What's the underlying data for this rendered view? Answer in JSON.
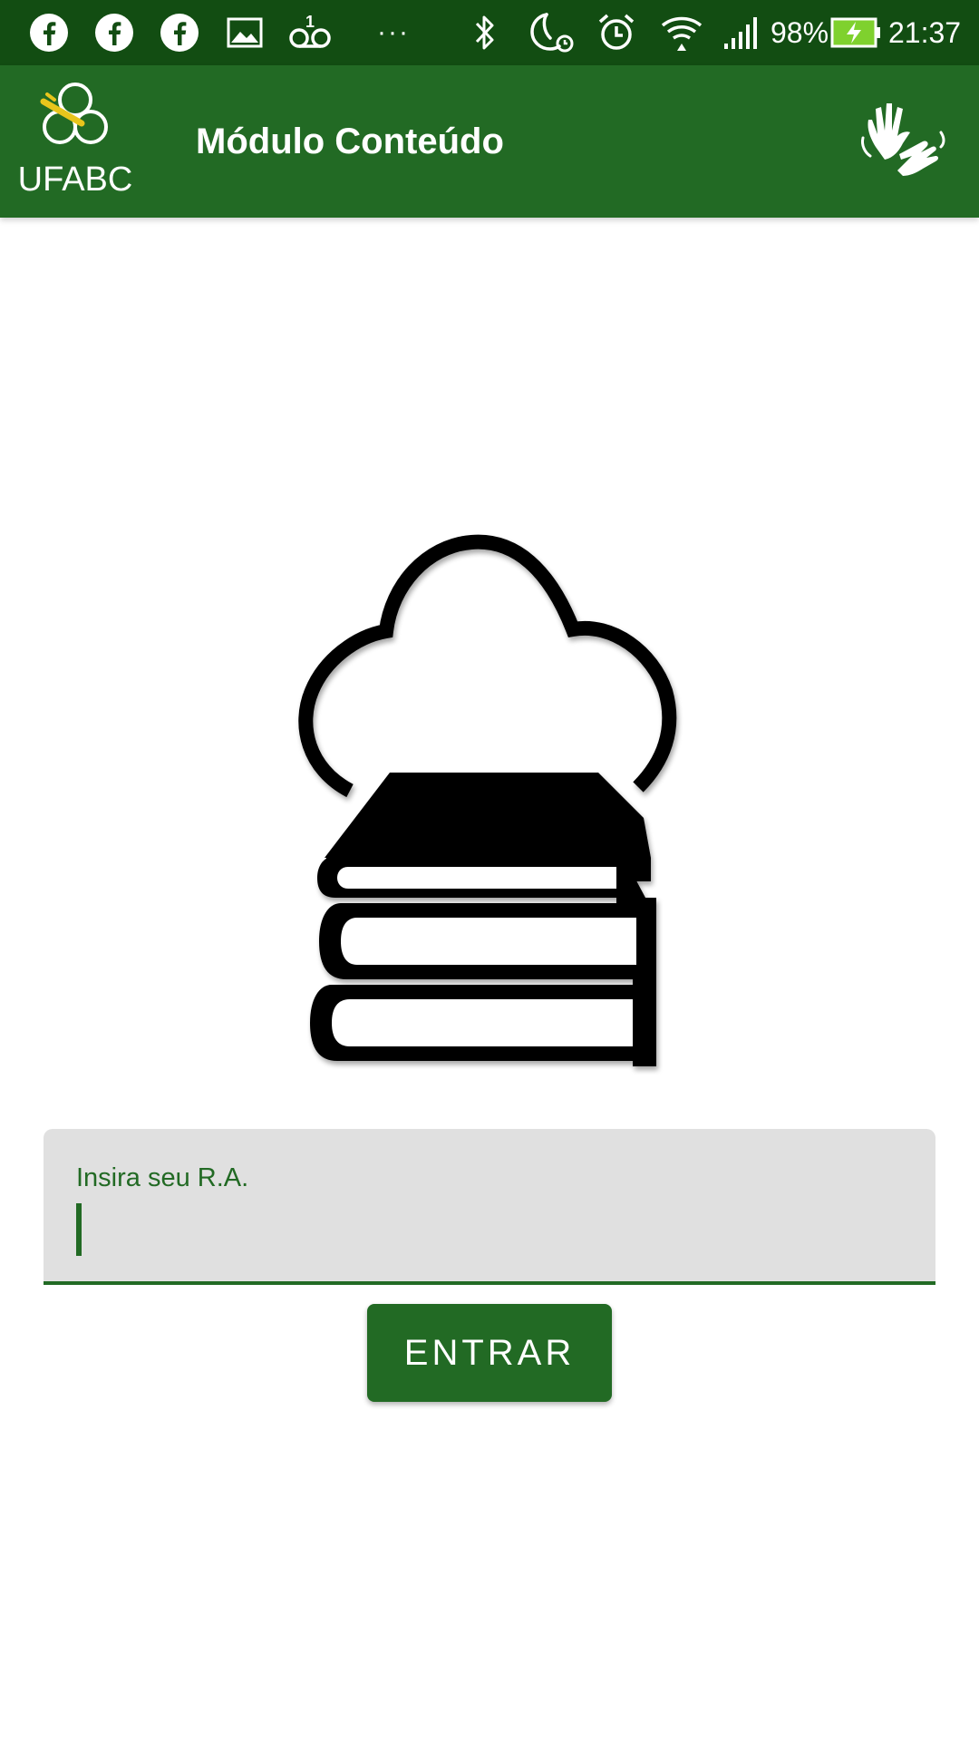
{
  "status_bar": {
    "battery_percent": "98%",
    "time": "21:37",
    "overflow": "···",
    "icons": [
      "facebook-icon",
      "facebook-icon",
      "facebook-icon",
      "image-icon",
      "voicemail-icon",
      "bluetooth-icon",
      "do-not-disturb-alarm-icon",
      "alarm-icon",
      "wifi-icon",
      "signal-icon",
      "battery-charging-icon"
    ]
  },
  "app_bar": {
    "logo_text": "UFABC",
    "title": "Módulo Conteúdo",
    "accessibility_icon": "sign-language-hands-icon"
  },
  "hero": {
    "icon": "cloud-books-icon"
  },
  "login": {
    "label": "Insira seu R.A.",
    "value": "",
    "button_label": "ENTRAR"
  },
  "colors": {
    "status_bar": "#124d12",
    "primary": "#226a24",
    "field_bg": "#e0e0e0",
    "logo_accent": "#e8c51c"
  }
}
